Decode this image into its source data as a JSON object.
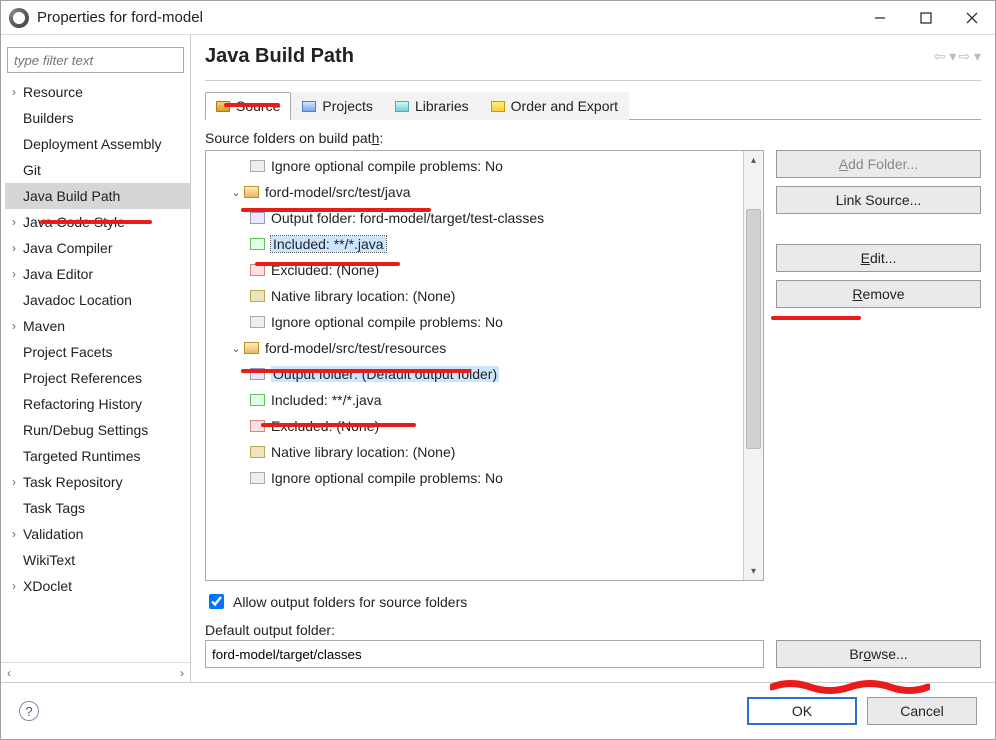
{
  "window_title": "Properties for ford-model",
  "filter_placeholder": "type filter text",
  "nav": {
    "items": [
      {
        "label": "Resource",
        "arrow": true
      },
      {
        "label": "Builders",
        "arrow": false
      },
      {
        "label": "Deployment Assembly",
        "arrow": false
      },
      {
        "label": "Git",
        "arrow": false
      },
      {
        "label": "Java Build Path",
        "arrow": false,
        "selected": true
      },
      {
        "label": "Java Code Style",
        "arrow": true
      },
      {
        "label": "Java Compiler",
        "arrow": true
      },
      {
        "label": "Java Editor",
        "arrow": true
      },
      {
        "label": "Javadoc Location",
        "arrow": false
      },
      {
        "label": "Maven",
        "arrow": true
      },
      {
        "label": "Project Facets",
        "arrow": false
      },
      {
        "label": "Project References",
        "arrow": false
      },
      {
        "label": "Refactoring History",
        "arrow": false
      },
      {
        "label": "Run/Debug Settings",
        "arrow": false
      },
      {
        "label": "Targeted Runtimes",
        "arrow": false
      },
      {
        "label": "Task Repository",
        "arrow": true
      },
      {
        "label": "Task Tags",
        "arrow": false
      },
      {
        "label": "Validation",
        "arrow": true
      },
      {
        "label": "WikiText",
        "arrow": false
      },
      {
        "label": "XDoclet",
        "arrow": true
      }
    ]
  },
  "page_title": "Java Build Path",
  "tabs": {
    "source": "Source",
    "projects": "Projects",
    "libraries": "Libraries",
    "order": "Order and Export"
  },
  "source_section_label": "Source folders on build path:",
  "tree": {
    "n0": {
      "label": "Ignore optional compile problems: No"
    },
    "n1": {
      "label": "ford-model/src/test/java"
    },
    "n1c": {
      "out": "Output folder: ford-model/target/test-classes",
      "inc": "Included: **/*.java",
      "exc": "Excluded: (None)",
      "nat": "Native library location: (None)",
      "ign": "Ignore optional compile problems: No"
    },
    "n2": {
      "label": "ford-model/src/test/resources"
    },
    "n2c": {
      "out": "Output folder: (Default output folder)",
      "inc": "Included: **/*.java",
      "exc": "Excluded: (None)",
      "nat": "Native library location: (None)",
      "ign": "Ignore optional compile problems: No"
    }
  },
  "buttons": {
    "add_folder": "Add Folder...",
    "link_source": "Link Source...",
    "edit": "Edit...",
    "remove": "Remove"
  },
  "allow_output_label": "Allow output folders for source folders",
  "default_output_label": "Default output folder:",
  "default_output_value": "ford-model/target/classes",
  "browse": "Browse...",
  "ok": "OK",
  "cancel": "Cancel"
}
